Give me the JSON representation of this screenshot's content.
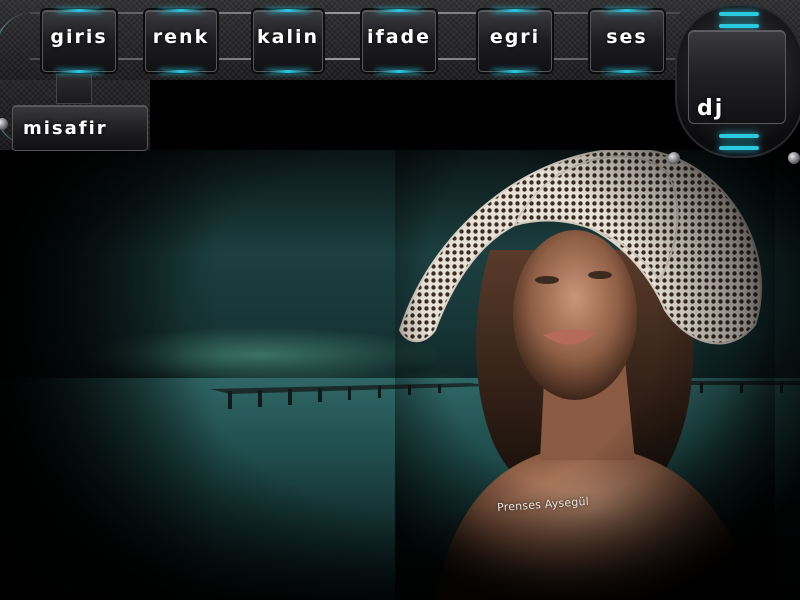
{
  "nav": {
    "buttons": [
      {
        "id": "giris",
        "label": "giris"
      },
      {
        "id": "renk",
        "label": "renk"
      },
      {
        "id": "kalin",
        "label": "kalin"
      },
      {
        "id": "ifade",
        "label": "ifade"
      },
      {
        "id": "egri",
        "label": "egri"
      },
      {
        "id": "ses",
        "label": "ses"
      }
    ],
    "guest_label": "misafir",
    "dj_label": "dj"
  },
  "scene": {
    "credit": "Prenses Aysegül"
  },
  "colors": {
    "accent_glow": "#2ac9e0",
    "panel": "#1e1e21",
    "sea": "#2f6766"
  }
}
